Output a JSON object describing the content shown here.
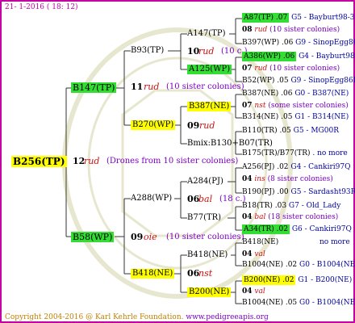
{
  "header": {
    "date": "21- 1-2016 ( 18: 12)"
  },
  "root": {
    "name": "B256(TP)",
    "num": "12",
    "abbr": "rud",
    "drones": "(Drones from 10 sister colonies)"
  },
  "g1": {
    "top": {
      "name": "B147(TP)",
      "num": "11",
      "abbr": "rud",
      "sisters": "(10 sister colonies)"
    },
    "bottom": {
      "name": "B58(WP)",
      "num": "09",
      "abbr": "oie",
      "sisters": "(10 sister colonies)"
    }
  },
  "g2": {
    "a": {
      "name": "B93(TP)"
    },
    "b": {
      "name": "B270(WP)",
      "num": "09",
      "abbr": "rud"
    },
    "c": {
      "name": "A288(WP)",
      "num": "06",
      "abbr": "bal",
      "extra": "(18 c.)"
    },
    "d": {
      "name": "B418(NE)",
      "num": "06",
      "abbr": "nst"
    }
  },
  "g3": {
    "a": {
      "name": "A147(TP)",
      "num": "10",
      "abbr": "rud",
      "extra": "(10 c.)"
    },
    "b": {
      "name": "A125(WP)"
    },
    "c": {
      "name": "B387(NE)",
      "num": "07",
      "abbr": "nst"
    },
    "d": {
      "name": "Bmix:B130+B07(TR)"
    },
    "e": {
      "name": "A284(PJ)",
      "num": "04",
      "abbr": "ins"
    },
    "f": {
      "name": "B77(TR)",
      "num": "04",
      "abbr": "bal"
    },
    "g": {
      "name": "B418(NE)",
      "num": "04",
      "abbr": "val"
    },
    "h": {
      "name": "B200(NE)",
      "num": "04",
      "abbr": "val"
    }
  },
  "g4": [
    {
      "box": "A87(TP) .07",
      "text": "G5 - Bayburt98-3"
    },
    {
      "num": "08",
      "abbr": "rud",
      "text": "(10 sister colonies)"
    },
    {
      "box": "B397(WP) .06",
      "text": "G9 - SinopEgg86R"
    },
    {
      "box": "A386(WP) .06",
      "text": "G4 - Bayburt98-3"
    },
    {
      "num": "07",
      "abbr": "rud",
      "text": "(10 sister colonies)"
    },
    {
      "box": "B52(WP) .05",
      "text": "G9 - SinopEgg86R"
    },
    {
      "box": "B387(NE) .06",
      "text": "G0 - B387(NE)"
    },
    {
      "num": "07",
      "abbr": "nst",
      "text": "(some sister colonies)"
    },
    {
      "box": "B314(NE) .05",
      "text": "G1 - B314(NE)"
    },
    {
      "box": "B110(TR) .05",
      "text": "G5 - MG00R"
    },
    {
      "box": "B175(TR)/B77(TR)",
      "text": ". no more"
    },
    {
      "box": "A256(PJ) .02",
      "text": "G4 - Cankiri97Q"
    },
    {
      "num": "04",
      "abbr": "ins",
      "text": "(8 sister colonies)"
    },
    {
      "box": "B190(PJ) .00",
      "text": "G5 - Sardasht93R"
    },
    {
      "box": "B18(TR) .03",
      "text": "G7 - Old_Lady"
    },
    {
      "num": "04",
      "abbr": "bal",
      "text": "(18 sister colonies)"
    },
    {
      "box": "A34(TR) .02",
      "text": "G6 - Cankiri97Q"
    },
    {
      "box": "B418(NE)",
      "text": "no more"
    },
    {
      "num": "04",
      "abbr": "val",
      "text": ""
    },
    {
      "box": "B1004(NE) .02",
      "text": "G0 - B1004(NE)"
    },
    {
      "box": "B200(NE) .02",
      "text": "G1 - B200(NE)"
    },
    {
      "num": "04",
      "abbr": "val",
      "text": ""
    },
    {
      "box": "B1004(NE) .05",
      "text": "G0 - B1004(NE)"
    }
  ],
  "footer": {
    "copyright": "Copyright 2004-2016 @ Karl Kehrle Foundation.",
    "url": "www.pedigreeapis.org"
  },
  "colors": {
    "frame": "#c000a0",
    "green": "#33dd33",
    "yellow": "#ffff00",
    "navy": "#000080",
    "red": "#d01010"
  }
}
